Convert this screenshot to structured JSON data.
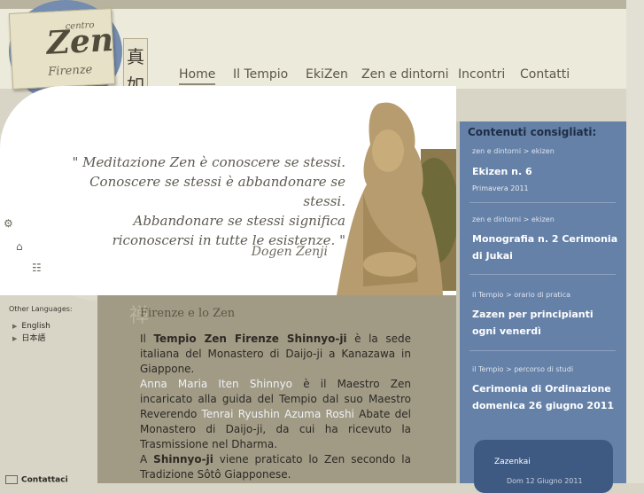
{
  "logo": {
    "centro": "centro",
    "zen": "Zen",
    "firenze": "Firenze",
    "kanji": "真\n如\n寺"
  },
  "nav": {
    "items": [
      "Home",
      "Il Tempio",
      "EkiZen",
      "Zen e dintorni",
      "Incontri",
      "Contatti"
    ],
    "active": "Home"
  },
  "hero": {
    "quote_lines": [
      "\" Meditazione Zen è conoscere se stessi.",
      "Conoscere se stessi è abbandonare se stessi.",
      "Abbandonare se stessi significa",
      "riconoscersi in tutte le esistenze. \""
    ],
    "author": "Dogen Zenji"
  },
  "sidebar": {
    "other_languages_label": "Other Languages:",
    "languages": [
      "English",
      "日本語"
    ],
    "contact_label": "Contattaci"
  },
  "main": {
    "title": "Firenze e lo Zen",
    "kanji": "禅",
    "p1_pre": "Il ",
    "p1_bold": "Tempio Zen Firenze Shinnyo-ji",
    "p1_post": " è la sede italiana del Monastero di Daijo-ji a Kanazawa in Giappone.",
    "p2_link": "Anna Maria Iten Shinnyo",
    "p2_text": " è il Maestro Zen incaricato alla guida del Tempio dal suo Maestro Reverendo ",
    "p2_link2": "Tenrai Ryushin Azuma Roshi",
    "p2_text2": " Abate del Monastero di Daijo-ji, da cui ha ricevuto la Trasmissione nel Dharma.",
    "p3_pre": "A ",
    "p3_bold": "Shinnyo-ji",
    "p3_post": " viene praticato lo Zen secondo la Tradizione Sôtô Giapponese."
  },
  "right": {
    "title": "Contenuti consigliati:",
    "items": [
      {
        "crumb": "zen e dintorni > ekizen",
        "title": "Ekizen n. 6",
        "date": "Primavera 2011"
      },
      {
        "crumb": "zen e dintorni > ekizen",
        "title": "Monografia n. 2 Cerimonia di Jukai"
      },
      {
        "crumb": "il Tempio > orario di pratica",
        "title": "Zazen per principianti ogni venerdì"
      },
      {
        "crumb": "il Tempio > percorso di studi",
        "title": "Cerimonia di Ordinazione domenica 26 giugno 2011"
      }
    ],
    "box": {
      "title": "Zazenkai",
      "date": "Dom 12 Giugno 2011"
    }
  },
  "colors": {
    "header": "#eceadb",
    "main_panel": "#a19b86",
    "right_panel": "#6581a8",
    "logo_circle": "#748cb0"
  }
}
